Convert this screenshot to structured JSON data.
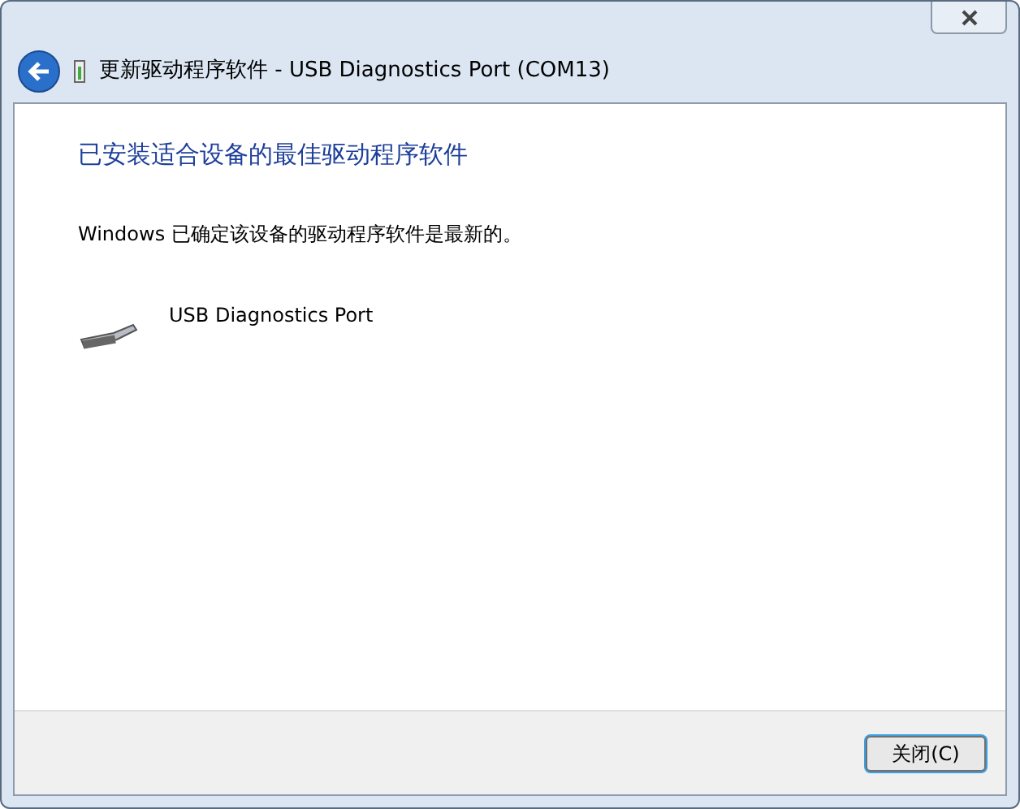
{
  "window": {
    "title": "更新驱动程序软件 - USB Diagnostics Port (COM13)"
  },
  "heading": "已安装适合设备的最佳驱动程序软件",
  "message": "Windows 已确定该设备的驱动程序软件是最新的。",
  "device": {
    "name": "USB Diagnostics Port"
  },
  "buttons": [
    "关闭(C)"
  ]
}
